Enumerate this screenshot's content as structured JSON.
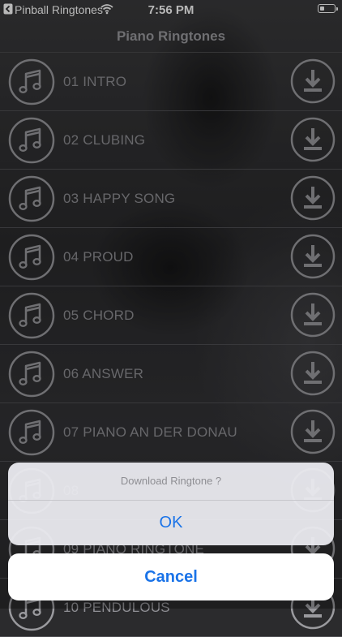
{
  "status_bar": {
    "back_app": "Pinball Ringtones",
    "time": "7:56 PM"
  },
  "nav": {
    "title": "Piano Ringtones"
  },
  "items": [
    {
      "label": "01  INTRO"
    },
    {
      "label": "02 CLUBING"
    },
    {
      "label": "03 HAPPY SONG"
    },
    {
      "label": "04 PROUD"
    },
    {
      "label": "05 CHORD"
    },
    {
      "label": "06 ANSWER"
    },
    {
      "label": "07 PIANO AN DER DONAU"
    },
    {
      "label": "08"
    },
    {
      "label": "09 PIANO RINGTONE"
    },
    {
      "label": "10 PENDULOUS"
    }
  ],
  "action_sheet": {
    "title": "Download Ringtone ?",
    "ok_label": "OK",
    "cancel_label": "Cancel"
  },
  "colors": {
    "accent": "#1a73e8",
    "icon_stroke": "#9a9a9e"
  },
  "icons": [
    "back-arrow-icon",
    "wifi-icon",
    "battery-icon",
    "music-note-icon",
    "download-icon"
  ]
}
